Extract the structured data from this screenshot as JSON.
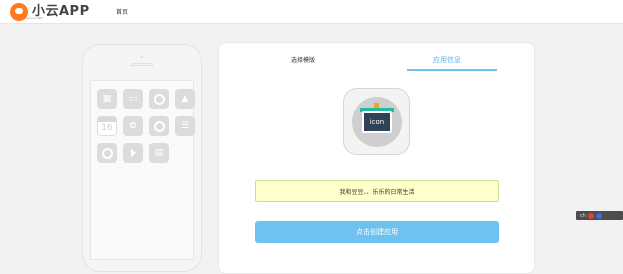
{
  "header": {
    "logo_text": "小云APP",
    "logo_sub": "xiaoyun APP",
    "nav_home": "首页"
  },
  "phone": {
    "calendar_day": "16",
    "icons": [
      "grid-icon",
      "chat-bubble-icon",
      "cloud-icon",
      "mountain-icon",
      "calendar-icon",
      "flower-icon",
      "camera-icon",
      "list-icon",
      "music-icon",
      "play-icon",
      "shop-icon"
    ]
  },
  "card": {
    "tab_template": "选择模版",
    "tab_info": "应用信息",
    "app_icon_label": "icon",
    "description": "我和豆豆、、乐乐的日常生活",
    "create_button": "点击创建应用"
  },
  "float_bar": {
    "label": "ch"
  },
  "colors": {
    "accent": "#6fc1f0",
    "brand": "#ff7a1a",
    "description_bg": "#ffffc9"
  }
}
